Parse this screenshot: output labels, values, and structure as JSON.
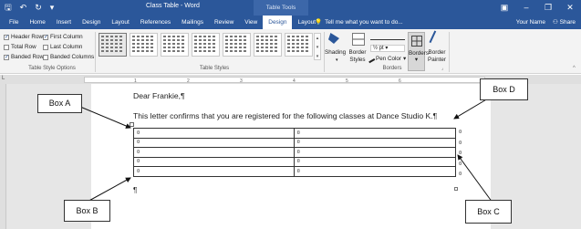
{
  "titlebar": {
    "title": "Class Table - Word",
    "table_tools": "Table Tools",
    "save_icon": "save-icon",
    "undo_icon": "undo-icon",
    "redo_icon": "redo-icon",
    "customize_icon": "customize-qat-icon"
  },
  "tabs": [
    "File",
    "Home",
    "Insert",
    "Design",
    "Layout",
    "References",
    "Mailings",
    "Review",
    "View",
    "Design",
    "Layout"
  ],
  "active_tab_index": 9,
  "tell_me": "Tell me what you want to do...",
  "user": {
    "name": "Your Name",
    "share": "Share"
  },
  "ribbon": {
    "style_options": {
      "items": [
        {
          "label": "Header Row",
          "checked": true
        },
        {
          "label": "First Column",
          "checked": true
        },
        {
          "label": "Total Row",
          "checked": false
        },
        {
          "label": "Last Column",
          "checked": false
        },
        {
          "label": "Banded Rows",
          "checked": true
        },
        {
          "label": "Banded Columns",
          "checked": false
        }
      ],
      "group_label": "Table Style Options"
    },
    "table_styles": {
      "group_label": "Table Styles"
    },
    "shading": "Shading",
    "border_styles": {
      "line1": "Border",
      "line2": "Styles"
    },
    "pen_weight": "½ pt",
    "pen_color": "Pen Color",
    "borders": "Borders",
    "border_painter": {
      "line1": "Border",
      "line2": "Painter"
    },
    "borders_group_label": "Borders"
  },
  "ruler_ticks": [
    "1",
    "2",
    "3",
    "4",
    "5",
    "6"
  ],
  "document": {
    "greeting": "Dear Frankie,¶",
    "body": "This letter confirms that you are registered for the following classes at Dance Studio K.¶",
    "cell_mark": "¤",
    "row_mark": "¤",
    "end_para": "¶",
    "table_rows": 5
  },
  "callouts": {
    "a": "Box A",
    "b": "Box B",
    "c": "Box C",
    "d": "Box D"
  }
}
